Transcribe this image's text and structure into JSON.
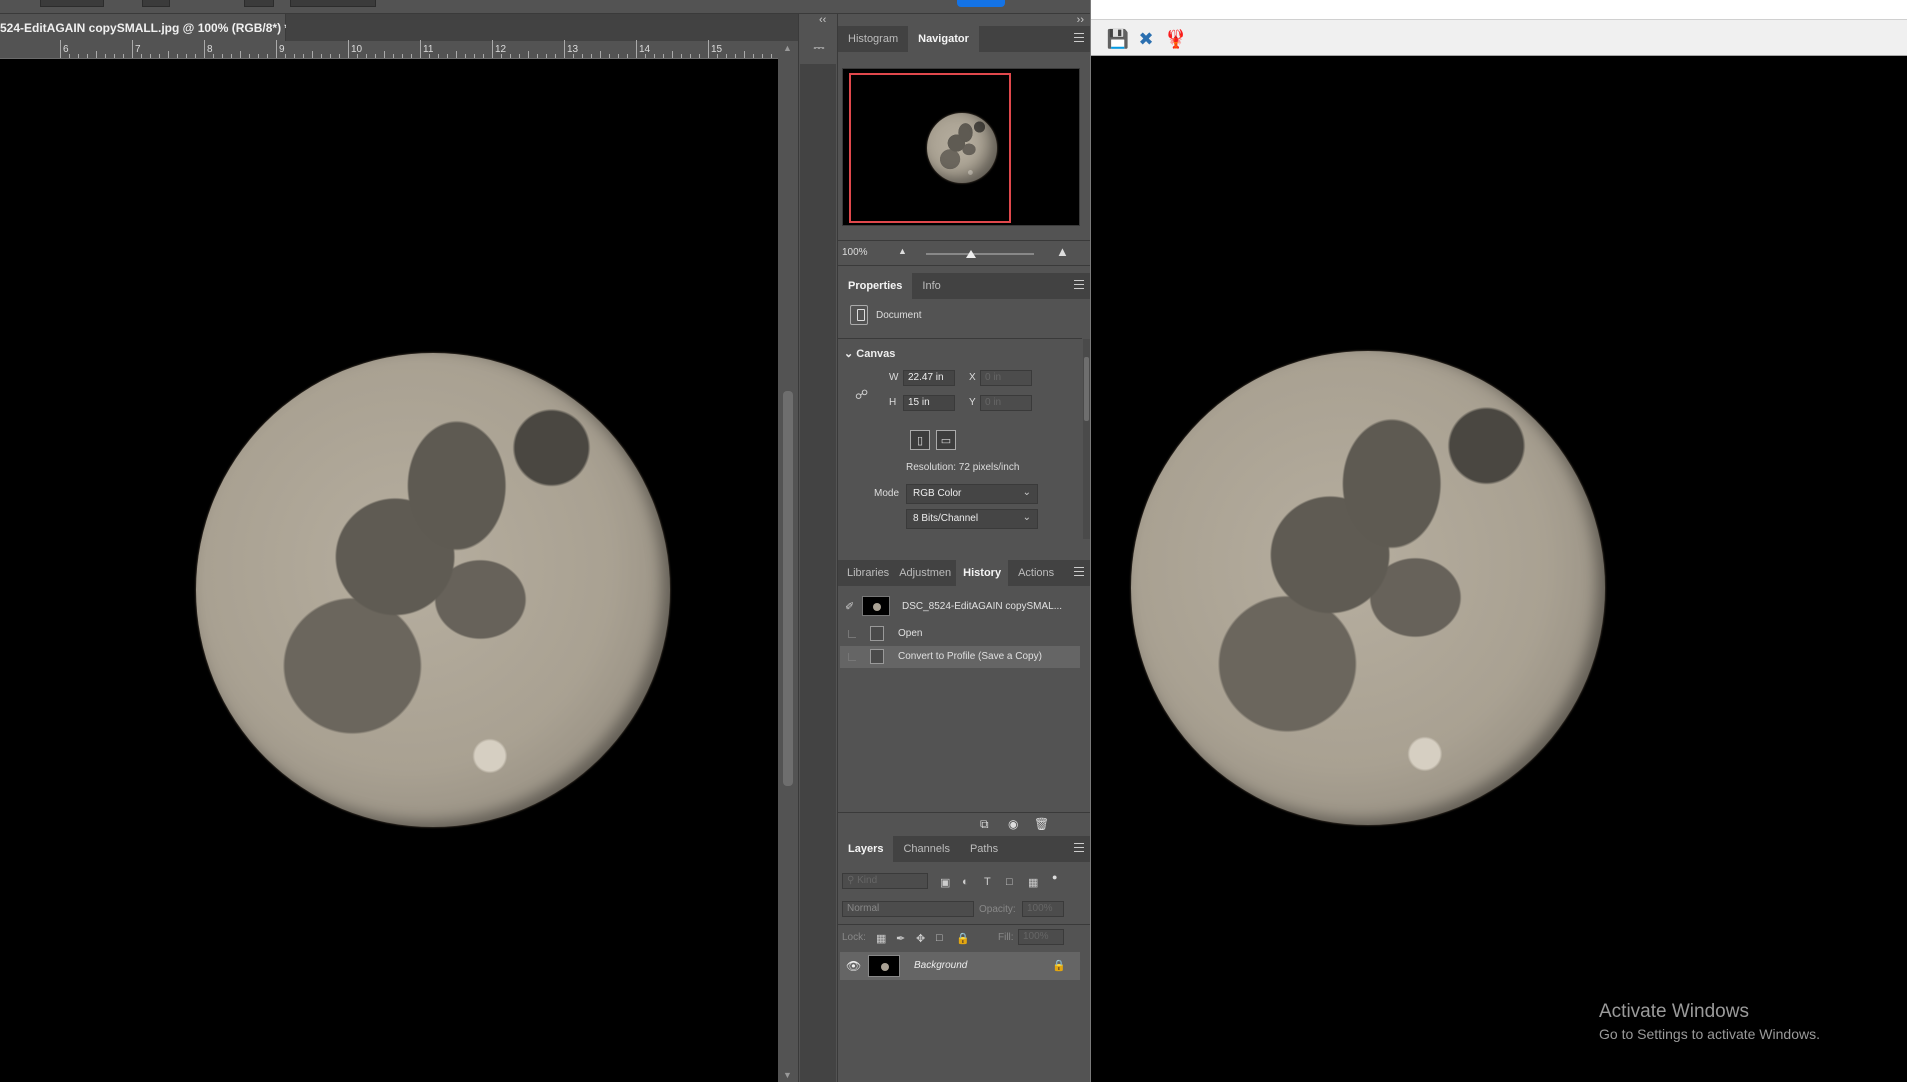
{
  "document": {
    "tab_title": "524-EditAGAIN copySMALL.jpg @ 100% (RGB/8*) *",
    "close_glyph": "×",
    "ruler_ticks": [
      "6",
      "7",
      "8",
      "9",
      "10",
      "11",
      "12",
      "13",
      "14",
      "15"
    ]
  },
  "panel_strip": {
    "collapse_glyph": "‹‹",
    "expand_glyph": "››"
  },
  "navigator_panel": {
    "tabs": [
      "Histogram",
      "Navigator"
    ],
    "active_tab": "Navigator",
    "zoom_value": "100%",
    "zoom_slider_level": 0.42
  },
  "properties_panel": {
    "tabs": [
      "Properties",
      "Info"
    ],
    "active_tab": "Properties",
    "document_label": "Document",
    "canvas_heading": "Canvas",
    "width_label": "W",
    "width_value": "22.47 in",
    "height_label": "H",
    "height_value": "15 in",
    "x_label": "X",
    "x_value": "0 in",
    "y_label": "Y",
    "y_value": "0 in",
    "resolution": "Resolution: 72 pixels/inch",
    "mode_label": "Mode",
    "mode_value": "RGB Color",
    "bit_depth_value": "8 Bits/Channel"
  },
  "history_panel": {
    "tabs": [
      "Libraries",
      "Adjustmen",
      "History",
      "Actions"
    ],
    "active_tab": "History",
    "snapshot_label": "DSC_8524-EditAGAIN copySMAL...",
    "states": [
      "Open",
      "Convert to Profile (Save a Copy)"
    ],
    "selected_state": "Convert to Profile (Save a Copy)"
  },
  "layers_panel": {
    "tabs": [
      "Layers",
      "Channels",
      "Paths"
    ],
    "active_tab": "Layers",
    "filter_placeholder": "Kind",
    "blend_mode": "Normal",
    "opacity_label": "Opacity:",
    "opacity_value": "100%",
    "lock_label": "Lock:",
    "fill_label": "Fill:",
    "fill_value": "100%",
    "layers": [
      {
        "name": "Background",
        "visible": true,
        "locked": true
      }
    ]
  },
  "windows_watermark": {
    "title": "Activate Windows",
    "subtitle": "Go to Settings to activate Windows."
  },
  "colors": {
    "ps_panel": "#535353",
    "ps_tabbar": "#424242",
    "navigator_view_box": "#e0484c",
    "viewer_toolbar": "#f0f0f0"
  },
  "icons": {
    "navigator_zoom_out": "small-mountain-icon",
    "navigator_zoom_in": "large-mountain-icon",
    "link": "chain-link-icon",
    "history_footer": [
      "new-document-from-state-icon",
      "camera-icon",
      "trash-icon"
    ],
    "viewer_toolbar": [
      "save-icon",
      "settings-tools-icon",
      "lobster-icon"
    ]
  }
}
